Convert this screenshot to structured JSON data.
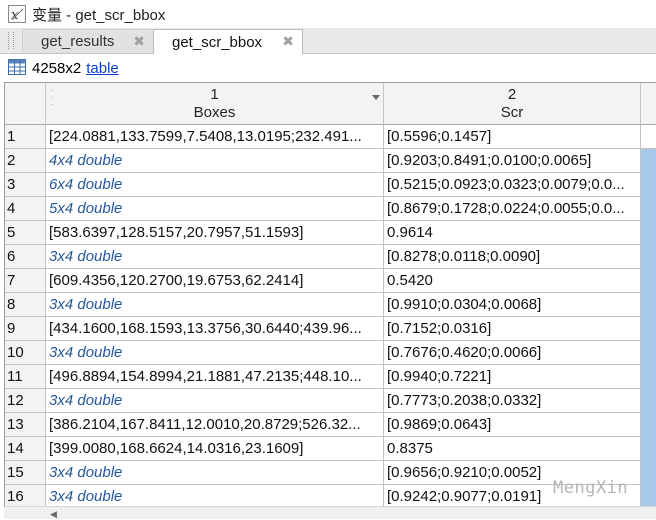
{
  "window": {
    "title": "变量 - get_scr_bbox"
  },
  "tabs": [
    {
      "label": "get_results",
      "active": false
    },
    {
      "label": "get_scr_bbox",
      "active": true
    }
  ],
  "close_glyph": "✖",
  "info": {
    "dims": "4258x2",
    "type_link": "table"
  },
  "columns": [
    {
      "index": "1",
      "name": "Boxes"
    },
    {
      "index": "2",
      "name": "Scr"
    }
  ],
  "rows": [
    {
      "n": "1",
      "boxes": "[224.0881,133.7599,7.5408,13.0195;232.491...",
      "boxes_italic": false,
      "scr": "[0.5596;0.1457]"
    },
    {
      "n": "2",
      "boxes": "4x4 double",
      "boxes_italic": true,
      "scr": "[0.9203;0.8491;0.0100;0.0065]"
    },
    {
      "n": "3",
      "boxes": "6x4 double",
      "boxes_italic": true,
      "scr": "[0.5215;0.0923;0.0323;0.0079;0.0..."
    },
    {
      "n": "4",
      "boxes": "5x4 double",
      "boxes_italic": true,
      "scr": "[0.8679;0.1728;0.0224;0.0055;0.0..."
    },
    {
      "n": "5",
      "boxes": "[583.6397,128.5157,20.7957,51.1593]",
      "boxes_italic": false,
      "scr": "0.9614"
    },
    {
      "n": "6",
      "boxes": "3x4 double",
      "boxes_italic": true,
      "scr": "[0.8278;0.0118;0.0090]"
    },
    {
      "n": "7",
      "boxes": "[609.4356,120.2700,19.6753,62.2414]",
      "boxes_italic": false,
      "scr": "0.5420"
    },
    {
      "n": "8",
      "boxes": "3x4 double",
      "boxes_italic": true,
      "scr": "[0.9910;0.0304;0.0068]"
    },
    {
      "n": "9",
      "boxes": "[434.1600,168.1593,13.3756,30.6440;439.96...",
      "boxes_italic": false,
      "scr": "[0.7152;0.0316]"
    },
    {
      "n": "10",
      "boxes": "3x4 double",
      "boxes_italic": true,
      "scr": "[0.7676;0.4620;0.0066]"
    },
    {
      "n": "11",
      "boxes": "[496.8894,154.8994,21.1881,47.2135;448.10...",
      "boxes_italic": false,
      "scr": "[0.9940;0.7221]"
    },
    {
      "n": "12",
      "boxes": "3x4 double",
      "boxes_italic": true,
      "scr": "[0.7773;0.2038;0.0332]"
    },
    {
      "n": "13",
      "boxes": "[386.2104,167.8411,12.0010,20.8729;526.32...",
      "boxes_italic": false,
      "scr": "[0.9869;0.0643]"
    },
    {
      "n": "14",
      "boxes": "[399.0080,168.6624,14.0316,23.1609]",
      "boxes_italic": false,
      "scr": "0.8375"
    },
    {
      "n": "15",
      "boxes": "3x4 double",
      "boxes_italic": true,
      "scr": "[0.9656;0.9210;0.0052]"
    },
    {
      "n": "16",
      "boxes": "3x4 double",
      "boxes_italic": true,
      "scr": "[0.9242;0.9077;0.0191]"
    }
  ],
  "watermark": "MengXin",
  "colors": {
    "link": "#0b3fcf",
    "italic_text": "#27579b",
    "selection": "#a8c8ea"
  }
}
